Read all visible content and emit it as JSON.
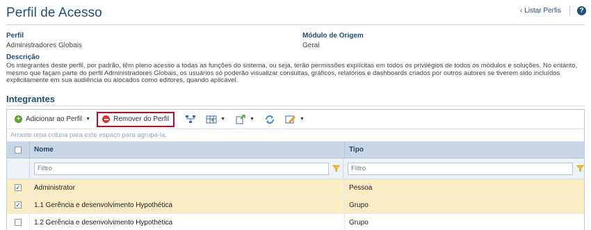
{
  "page": {
    "title": "Perfil de Acesso",
    "list_link": "Listar Perfis",
    "help_symbol": "?"
  },
  "fields": {
    "perfil_label": "Perfil",
    "perfil_value": "Administradores Globais",
    "modulo_label": "Módulo de Origem",
    "modulo_value": "Geral",
    "descricao_label": "Descrição",
    "descricao_value": "Os integrantes deste perfil, por padrão, têm pleno acesso a todas as funções do sistema, ou seja, terão permissões explícitas em todos os privilégios de todos os módulos e soluções. No entanto, mesmo que façam parte do perfil Administradores Globais, os usuários só poderão visualizar consultas, gráficos, relatórios e dashboards criados por outros autores se tiverem sido incluídos explicitamente em sua audiência ou alocados como editores, quando aplicável."
  },
  "section": {
    "title": "Integrantes"
  },
  "toolbar": {
    "add_label": "Adicionar ao Perfil",
    "remove_label": "Remover do Perfil"
  },
  "grid": {
    "group_hint": "Arraste uma coluna para este espaço para agrupá-la.",
    "columns": {
      "name": "Nome",
      "type": "Tipo"
    },
    "filter_placeholder": "Filtro",
    "rows": [
      {
        "name": "Administrator",
        "type": "Pessoa",
        "checked": true
      },
      {
        "name": "1.1 Gerência e desenvolvimento Hypothética",
        "type": "Grupo",
        "checked": true
      },
      {
        "name": "1.2 Gerência e desenvolvimento Hypothética",
        "type": "Grupo",
        "checked": false
      }
    ]
  },
  "colors": {
    "title": "#1f4e79",
    "header_bg": "#c8d7e8",
    "selected_row": "#fbecc4",
    "highlight_border": "#d0021b"
  }
}
